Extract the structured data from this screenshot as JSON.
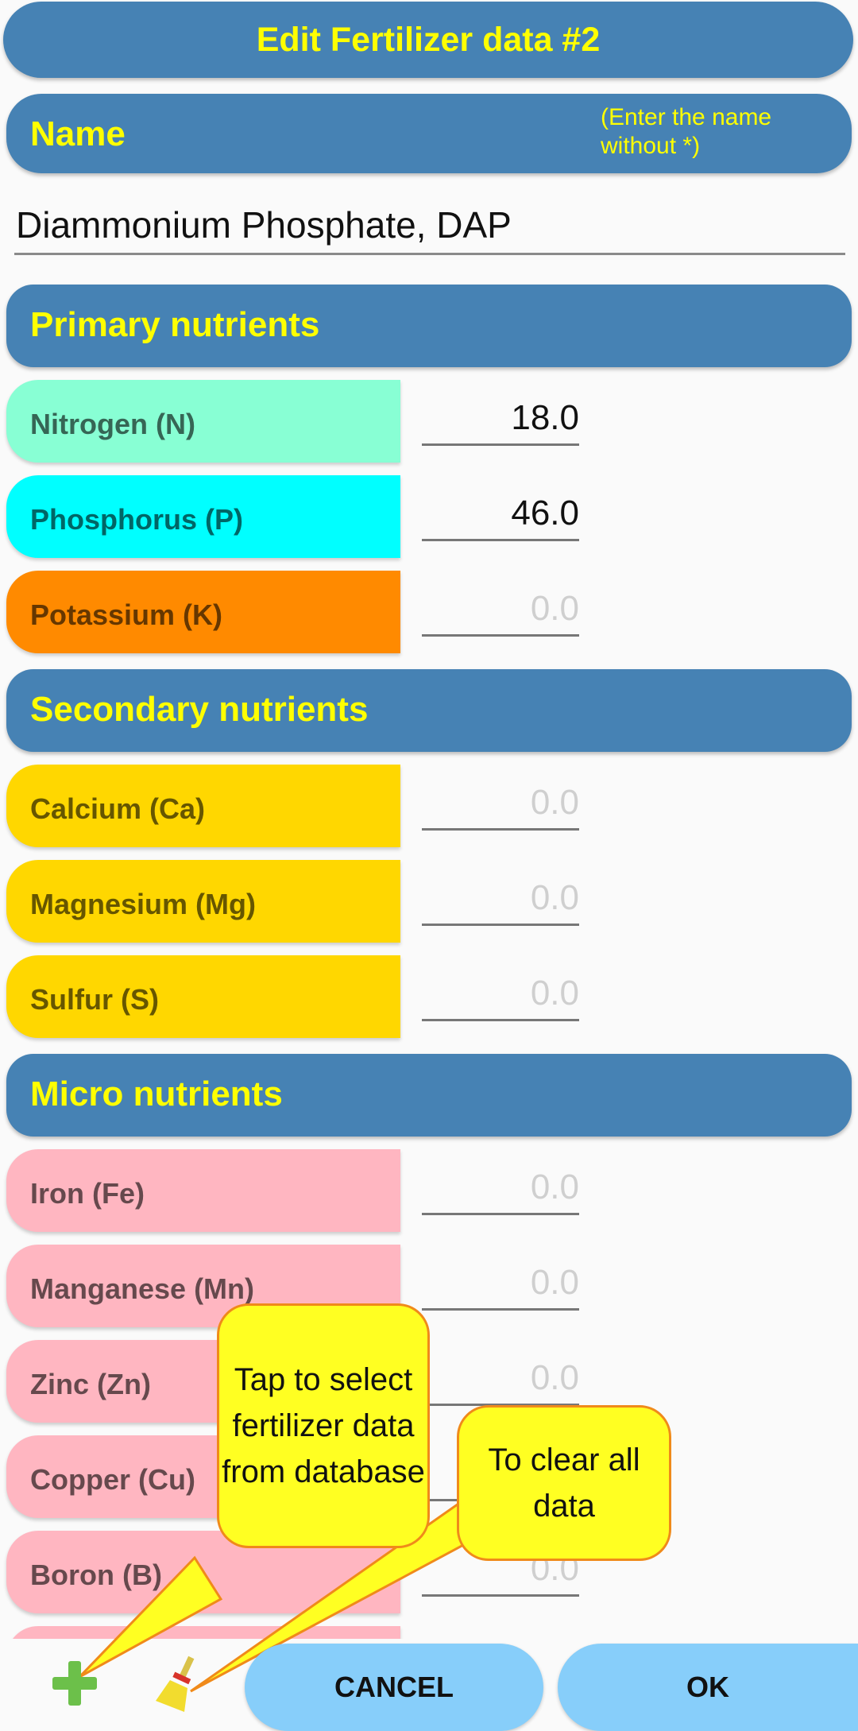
{
  "title": "Edit Fertilizer data #2",
  "name_section": {
    "label": "Name",
    "hint": "(Enter the name without *)",
    "value": "Diammonium Phosphate, DAP"
  },
  "sections": [
    {
      "title": "Primary nutrients",
      "items": [
        {
          "label": "Nitrogen (N)",
          "value": "18.0",
          "placeholder": "0.0",
          "color": "#88ffd4"
        },
        {
          "label": "Phosphorus (P)",
          "value": "46.0",
          "placeholder": "0.0",
          "color": "#00ffff"
        },
        {
          "label": "Potassium (K)",
          "value": "",
          "placeholder": "0.0",
          "color": "#ff8a00"
        }
      ]
    },
    {
      "title": "Secondary nutrients",
      "items": [
        {
          "label": "Calcium (Ca)",
          "value": "",
          "placeholder": "0.0",
          "color": "#ffd700"
        },
        {
          "label": "Magnesium (Mg)",
          "value": "",
          "placeholder": "0.0",
          "color": "#ffd700"
        },
        {
          "label": "Sulfur (S)",
          "value": "",
          "placeholder": "0.0",
          "color": "#ffd700"
        }
      ]
    },
    {
      "title": "Micro nutrients",
      "items": [
        {
          "label": "Iron (Fe)",
          "value": "",
          "placeholder": "0.0",
          "color": "#ffb6c1"
        },
        {
          "label": "Manganese (Mn)",
          "value": "",
          "placeholder": "0.0",
          "color": "#ffb6c1"
        },
        {
          "label": "Zinc (Zn)",
          "value": "",
          "placeholder": "0.0",
          "color": "#ffb6c1"
        },
        {
          "label": "Copper (Cu)",
          "value": "",
          "placeholder": "0.0",
          "color": "#ffb6c1"
        },
        {
          "label": "Boron (B)",
          "value": "",
          "placeholder": "0.0",
          "color": "#ffb6c1"
        }
      ]
    }
  ],
  "callouts": {
    "add": "Tap to select fertilizer data from database",
    "clear": "To clear all data"
  },
  "footer": {
    "add_icon": "plus-icon",
    "clear_icon": "broom-icon",
    "cancel_label": "CANCEL",
    "ok_label": "OK"
  },
  "colors": {
    "header_bg": "#4682b4",
    "header_text": "#ffff00",
    "button_bg": "#87cefa"
  }
}
